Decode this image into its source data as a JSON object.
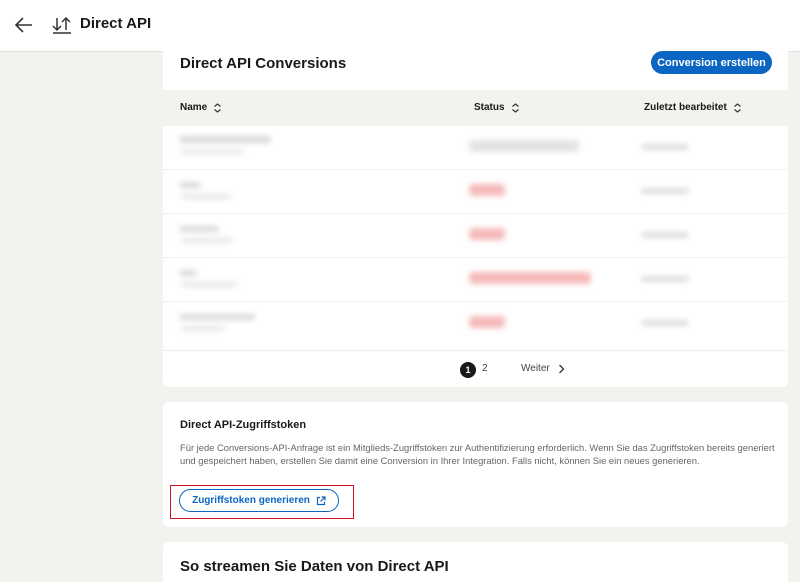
{
  "header": {
    "title": "Direct API"
  },
  "conversions": {
    "title": "Direct API Conversions",
    "create_button": "Conversion erstellen",
    "columns": [
      "Name",
      "Status",
      "Zuletzt bearbeitet"
    ],
    "pagination": {
      "current_page": "1",
      "next_page": "2",
      "next_label": "Weiter"
    }
  },
  "token": {
    "title": "Direct API-Zugriffstoken",
    "description": "Für jede Conversions-API-Anfrage ist ein Mitglieds-Zugriffstoken zur Authentifizierung erforderlich. Wenn Sie das Zugriffstoken bereits generiert und gespeichert haben, erstellen Sie damit eine Conversion in Ihrer Integration. Falls nicht, können Sie ein neues generieren.",
    "generate_button": "Zugriffstoken generieren"
  },
  "streaming": {
    "title": "So streamen Sie Daten von Direct API"
  },
  "colors": {
    "primary": "#0a66c2",
    "background": "#f3f2ef",
    "highlight": "#d11124"
  },
  "icons": {
    "back": "arrow-left-icon",
    "sort": "sort-arrows-icon",
    "column_sort": "chevron-up-down-icon",
    "next": "chevron-right-icon",
    "external": "external-link-icon"
  }
}
